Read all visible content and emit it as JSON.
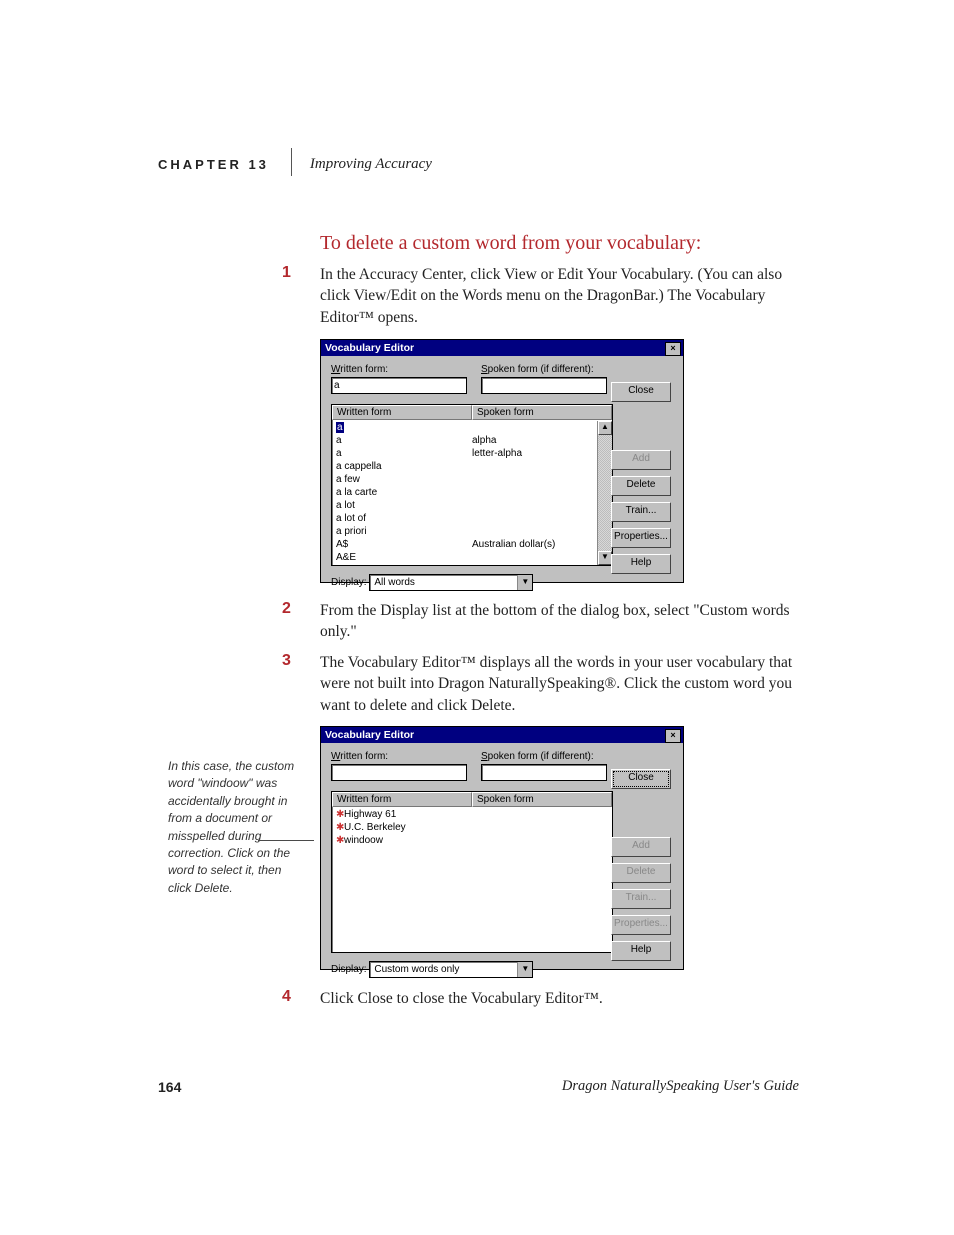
{
  "header": {
    "chapter_label": "CHAPTER 13",
    "chapter_title": "Improving Accuracy"
  },
  "heading": "To delete a custom word from your vocabulary:",
  "steps": {
    "n1": "1",
    "t1": "In the Accuracy Center, click View or Edit Your Vocabulary. (You can also click View/Edit on the Words menu on the DragonBar.) The Vocabulary Editor™ opens.",
    "n2": "2",
    "t2": "From the Display list at the bottom of the dialog box, select \"Custom words only.\"",
    "n3": "3",
    "t3": "The Vocabulary Editor™ displays all the words in your user vocabulary that were not built into Dragon NaturallySpeaking®. Click the custom word you want to delete and click Delete.",
    "n4": "4",
    "t4": "Click Close to close the Vocabulary Editor™."
  },
  "sidenote": "In this case, the custom word \"windoow\" was accidentally brought in from a document or misspelled during correction. Click on the word to select it, then click Delete.",
  "dialog1": {
    "title": "Vocabulary Editor",
    "written_label": "Written form:",
    "spoken_label": "Spoken form (if different):",
    "written_value": "a",
    "col1": "Written form",
    "col2": "Spoken form",
    "rows": [
      {
        "w": "a",
        "s": "",
        "sel": true
      },
      {
        "w": "a",
        "s": "alpha"
      },
      {
        "w": "a",
        "s": "letter-alpha"
      },
      {
        "w": "a cappella",
        "s": ""
      },
      {
        "w": "a few",
        "s": ""
      },
      {
        "w": "a la carte",
        "s": ""
      },
      {
        "w": "a lot",
        "s": ""
      },
      {
        "w": "a lot of",
        "s": ""
      },
      {
        "w": "a priori",
        "s": ""
      },
      {
        "w": "A$",
        "s": "Australian dollar(s)"
      },
      {
        "w": "A&E",
        "s": ""
      }
    ],
    "display_label": "Display:",
    "display_value": "All words",
    "buttons": {
      "close": "Close",
      "add": "Add",
      "delete": "Delete",
      "train": "Train...",
      "properties": "Properties...",
      "help": "Help"
    }
  },
  "dialog2": {
    "title": "Vocabulary Editor",
    "written_label": "Written form:",
    "spoken_label": "Spoken form (if different):",
    "col1": "Written form",
    "col2": "Spoken form",
    "rows": [
      {
        "w": "Highway 61",
        "s": ""
      },
      {
        "w": "U.C. Berkeley",
        "s": ""
      },
      {
        "w": "windoow",
        "s": ""
      }
    ],
    "display_label": "Display:",
    "display_value": "Custom words only",
    "buttons": {
      "close": "Close",
      "add": "Add",
      "delete": "Delete",
      "train": "Train...",
      "properties": "Properties...",
      "help": "Help"
    }
  },
  "footer": {
    "page": "164",
    "title": "Dragon NaturallySpeaking User's Guide"
  }
}
